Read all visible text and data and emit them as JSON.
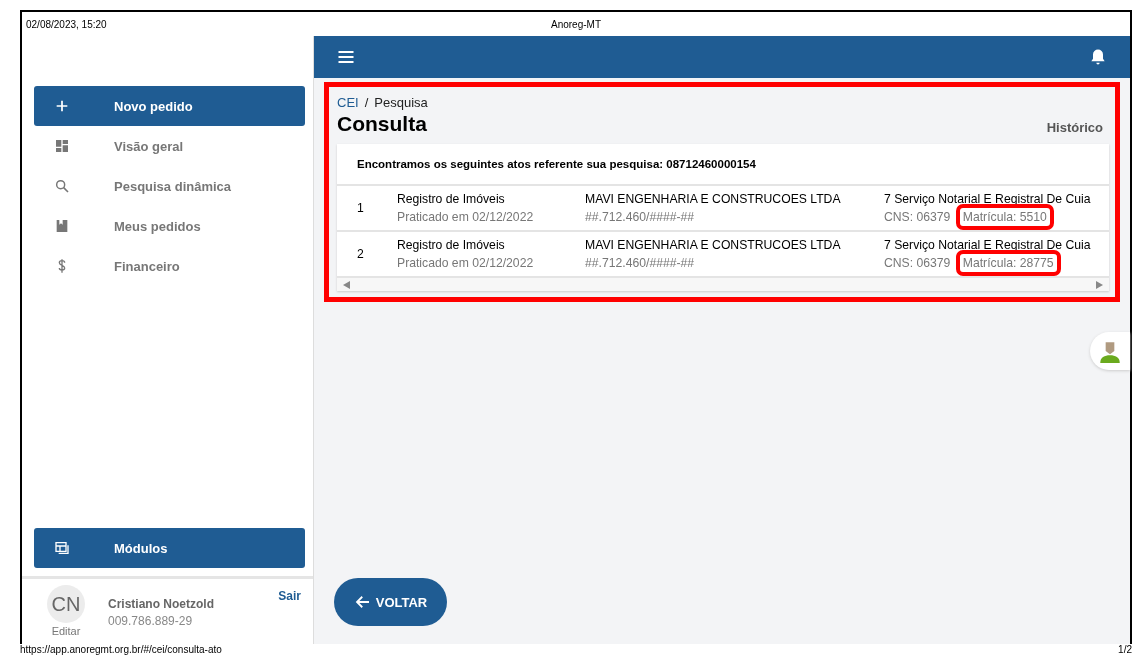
{
  "print_header": {
    "date": "02/08/2023, 15:20",
    "title": "Anoreg-MT"
  },
  "sidebar": {
    "items": [
      {
        "label": "Novo pedido",
        "kind": "primary"
      },
      {
        "label": "Visão geral",
        "kind": "link"
      },
      {
        "label": "Pesquisa dinâmica",
        "kind": "link"
      },
      {
        "label": "Meus pedidos",
        "kind": "link"
      },
      {
        "label": "Financeiro",
        "kind": "link"
      }
    ],
    "modules_button": "Módulos",
    "user": {
      "initials": "CN",
      "edit": "Editar",
      "name": "Cristiano Noetzold",
      "document": "009.786.889-29",
      "logout": "Sair"
    }
  },
  "breadcrumb": [
    {
      "label": "CEI",
      "link": true
    },
    {
      "label": "/",
      "link": false
    },
    {
      "label": "Pesquisa",
      "link": false
    }
  ],
  "page_title": "Consulta",
  "history_link": "Histórico",
  "results": {
    "highlighted": true,
    "summary": "Encontramos os seguintes atos referente sua pesquisa: 08712460000154",
    "rows": [
      {
        "index": "1",
        "service": "Registro de Imóveis",
        "date": "Praticado em 02/12/2022",
        "party": "MAVI ENGENHARIA E CONSTRUCOES LTDA",
        "document": "##.712.460/####-##",
        "office": "7 Serviço Notarial E Registral De Cuia",
        "cns": "CNS: 06379",
        "registration": "Matrícula: 5510",
        "registration_highlighted": true
      },
      {
        "index": "2",
        "service": "Registro de Imóveis",
        "date": "Praticado em 02/12/2022",
        "party": "MAVI ENGENHARIA E CONSTRUCOES LTDA",
        "document": "##.712.460/####-##",
        "office": "7 Serviço Notarial E Registral De Cuia",
        "cns": "CNS: 06379",
        "registration": "Matrícula: 28775",
        "registration_highlighted": true
      }
    ]
  },
  "back_button": "VOLTAR",
  "print_footer": {
    "url": "https://app.anoregmt.org.br/#/cei/consulta-ato",
    "page": "1/2"
  }
}
